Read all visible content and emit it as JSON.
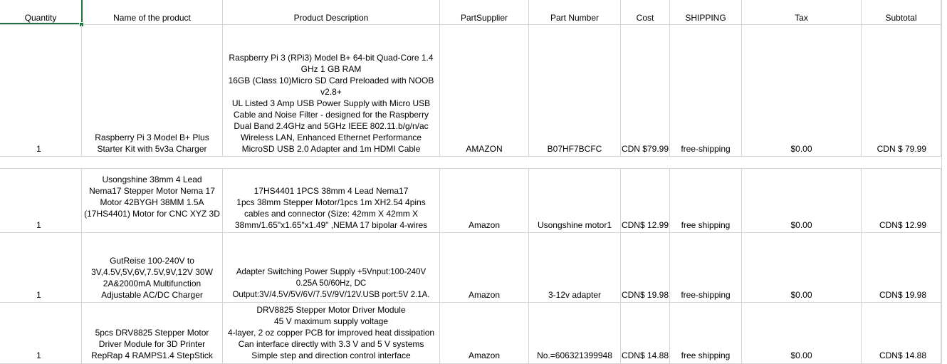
{
  "headers": {
    "quantity": "Quantity",
    "name": "Name of the product",
    "description": "Product Description",
    "supplier": "PartSupplier",
    "part_number": "Part Number",
    "cost": "Cost",
    "shipping": "SHIPPING",
    "tax": "Tax",
    "subtotal": "Subtotal"
  },
  "rows": [
    {
      "quantity": "1",
      "name": "Raspberry Pi 3 Model B+ Plus\nStarter Kit with 5v3a Charger",
      "description": "Raspberry Pi 3 (RPi3) Model B+ 64-bit Quad-Core 1.4\nGHz 1 GB RAM\n16GB (Class 10)Micro SD Card Preloaded with NOOB\nv2.8+\nUL Listed 3 Amp USB Power Supply with Micro USB\nCable and Noise Filter - designed for the Raspberry\nDual Band 2.4GHz and 5GHz IEEE 802.11.b/g/n/ac\nWireless LAN,  Enhanced Ethernet Performance\nMicroSD USB 2.0 Adapter and 1m HDMI Cable",
      "supplier": "AMAZON",
      "part_number": "B07HF7BCFC",
      "cost": "CDN $79.99",
      "shipping": "free-shipping",
      "tax": "$0.00",
      "subtotal": "CDN $ 79.99"
    },
    {
      "quantity": "1",
      "name": "Usongshine 38mm 4 Lead\nNema17 Stepper Motor Nema 17\nMotor 42BYGH 38MM 1.5A\n(17HS4401) Motor for CNC XYZ 3D",
      "description": "17HS4401 1PCS 38mm 4 Lead Nema17\n1pcs 38mm Stepper Motor/1pcs 1m XH2.54 4pins\ncables and connector (Size: 42mm X 42mm X\n38mm/1.65\"x1.65\"x1.49\" ,NEMA 17 bipolar 4-wires",
      "supplier": "Amazon",
      "part_number": "Usongshine motor1",
      "cost": "CDN$ 12.99",
      "shipping": "free shipping",
      "tax": "$0.00",
      "subtotal": "CDN$ 12.99"
    },
    {
      "quantity": "1",
      "name": "GutReise 100-240V to\n3V,4.5V,5V,6V,7.5V,9V,12V 30W\n2A&2000mA Multifunction\nAdjustable AC/DC Charger",
      "description": "Adapter Switching Power Supply +5Vnput:100-240V\n0.25A 50/60Hz, DC\nOutput:3V/4.5V/5V/6V/7.5V/9V/12V.USB port:5V 2.1A.",
      "supplier": "Amazon",
      "part_number": "3-12v adapter",
      "cost": "CDN$ 19.98",
      "shipping": "free-shipping",
      "tax": "$0.00",
      "subtotal": "CDN$ 19.98"
    },
    {
      "quantity": "1",
      "name": "5pcs DRV8825 Stepper Motor\nDriver Module for 3D Printer\nRepRap 4 RAMPS1.4 StepStick",
      "description": "DRV8825 Stepper Motor Driver Module\n45 V maximum supply voltage\n4-layer, 2 oz copper PCB for improved heat dissipation\nCan interface directly with 3.3 V and 5 V systems\nSimple step and direction control interface",
      "supplier": "Amazon",
      "part_number": "No.=606321399948",
      "cost": "CDN$ 14.88",
      "shipping": "free shipping",
      "tax": "$0.00",
      "subtotal": "CDN$ 14.88"
    }
  ]
}
